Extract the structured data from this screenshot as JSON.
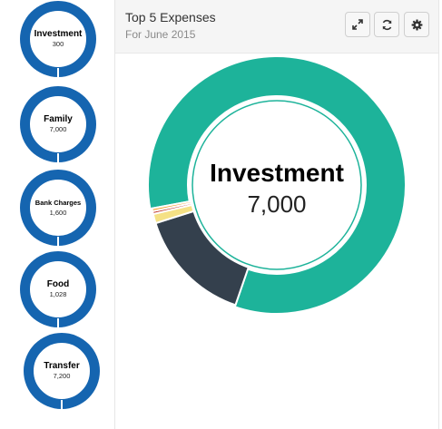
{
  "sidebar": {
    "items": [
      {
        "label": "Investment",
        "value": "300"
      },
      {
        "label": "Family",
        "value": "7,000"
      },
      {
        "label": "Bank Charges",
        "value": "1,600"
      },
      {
        "label": "Food",
        "value": "1,028"
      },
      {
        "label": "Transfer",
        "value": "7,200"
      }
    ],
    "ring_color": "#1565b0"
  },
  "panel": {
    "title": "Top 5 Expenses",
    "subtitle": "For June 2015",
    "buttons": [
      {
        "icon": "expand-icon"
      },
      {
        "icon": "refresh-icon"
      },
      {
        "icon": "gear-icon"
      }
    ]
  },
  "chart_data": {
    "type": "pie",
    "center_label": "Investment",
    "center_value": "7,000",
    "categories": [
      "Investment",
      "Family",
      "Bank Charges",
      "Food",
      "Transfer"
    ],
    "values": [
      7000,
      1250,
      100,
      30,
      30
    ],
    "colors": [
      "#1db39a",
      "#34404d",
      "#f5e185",
      "#c0392b",
      "#f29b24"
    ],
    "selected": "Investment"
  }
}
